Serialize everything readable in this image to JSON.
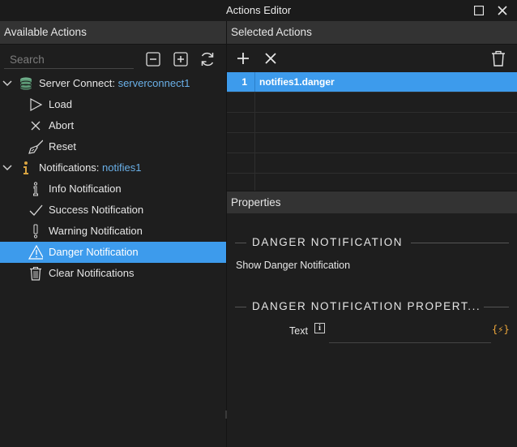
{
  "window": {
    "title": "Actions Editor"
  },
  "left_panel": {
    "header": "Available Actions",
    "search_placeholder": "Search",
    "tree": {
      "groups": [
        {
          "label": "Server Connect:",
          "instance": "serverconnect1",
          "icon": "database-icon",
          "items": [
            {
              "label": "Load",
              "icon": "play-outline-icon"
            },
            {
              "label": "Abort",
              "icon": "x-icon"
            },
            {
              "label": "Reset",
              "icon": "broom-icon"
            }
          ]
        },
        {
          "label": "Notifications:",
          "instance": "notifies1",
          "icon": "info-icon",
          "items": [
            {
              "label": "Info Notification",
              "icon": "info-outline-icon"
            },
            {
              "label": "Success Notification",
              "icon": "check-icon"
            },
            {
              "label": "Warning Notification",
              "icon": "exclamation-icon"
            },
            {
              "label": "Danger Notification",
              "icon": "warning-triangle-icon",
              "selected": true
            },
            {
              "label": "Clear Notifications",
              "icon": "trash-icon"
            }
          ]
        }
      ]
    }
  },
  "right_panel": {
    "header": "Selected Actions",
    "selected_actions": [
      {
        "index": "1",
        "value": "notifies1.danger"
      }
    ],
    "properties": {
      "header": "Properties",
      "section_title": "DANGER NOTIFICATION",
      "description": "Show Danger Notification",
      "subsection_title": "DANGER NOTIFICATION PROPERT...",
      "text_field": {
        "label": "Text",
        "info_glyph": "i",
        "value": "",
        "dynamic_button": "{⚡}"
      }
    }
  },
  "colors": {
    "selection": "#3d9bec",
    "header_bg": "#333333",
    "accent_text": "#6ab0e8",
    "dynamic": "#f0a93b",
    "database_icon": "#6fae8a",
    "info_icon": "#d9a441"
  }
}
